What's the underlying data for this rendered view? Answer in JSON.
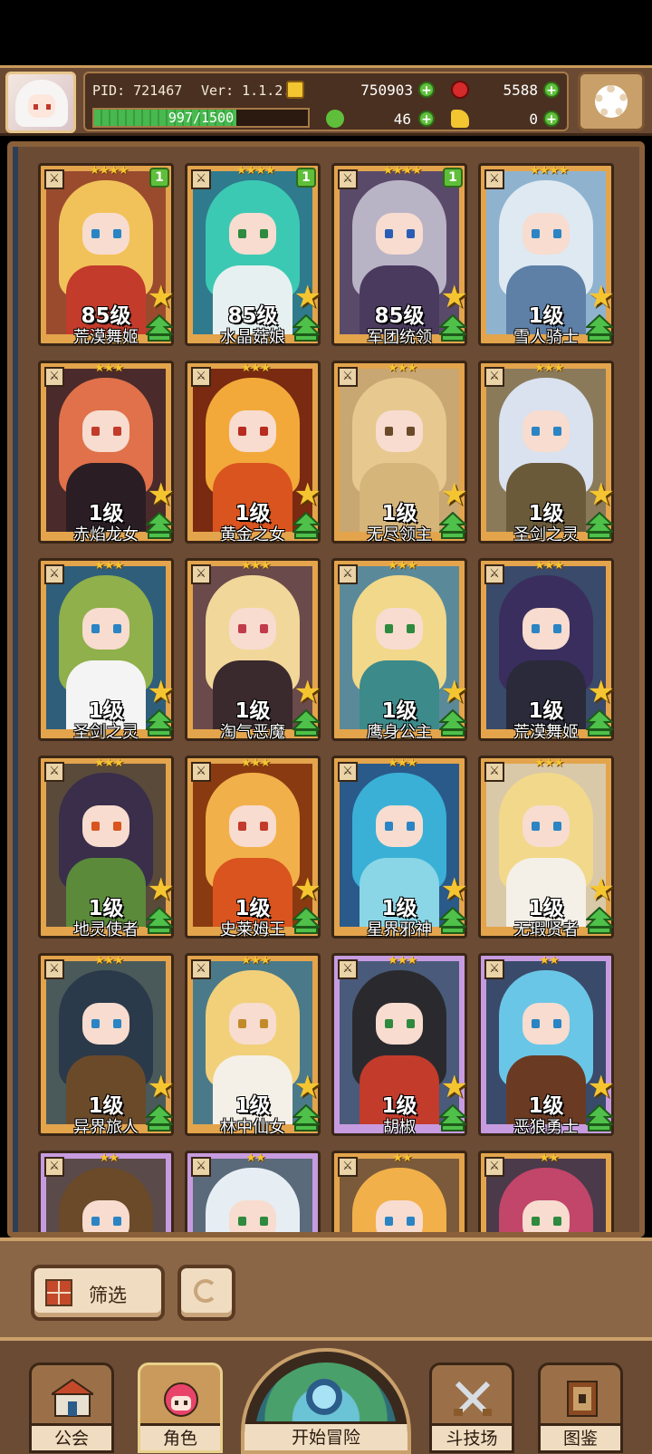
{
  "player": {
    "pid": "PID: 721467",
    "version": "Ver: 1.1.2.0",
    "exp_text": "997/1500",
    "exp_progress": 0.665
  },
  "resources": {
    "gold": "750903",
    "gems": "5588",
    "clover": "46",
    "horn": "0"
  },
  "heroes": [
    {
      "level": "85级",
      "name": "荒漠舞姬",
      "stars": "★★★★",
      "badge": "1",
      "frame": "orange",
      "hair": "#f2c25a",
      "outfit": "#c23b2b",
      "eye": "#2b84c4",
      "bg": "#9a4b2e"
    },
    {
      "level": "85级",
      "name": "水晶菇娘",
      "stars": "★★★★",
      "badge": "1",
      "frame": "orange",
      "hair": "#3cc9b4",
      "outfit": "#e7f0f0",
      "eye": "#2e8a3e",
      "bg": "#2f7a8c"
    },
    {
      "level": "85级",
      "name": "军团统领",
      "stars": "★★★★",
      "badge": "1",
      "frame": "orange",
      "hair": "#b9b3c6",
      "outfit": "#4a3a5e",
      "eye": "#2b5db6",
      "bg": "#5a4a6a"
    },
    {
      "level": "1级",
      "name": "雪人骑士",
      "stars": "★★★★",
      "badge": "",
      "frame": "orange",
      "hair": "#dfe9f2",
      "outfit": "#5e7fa6",
      "eye": "#2b84c4",
      "bg": "#8fb3cf"
    },
    {
      "level": "1级",
      "name": "赤焰龙女",
      "stars": "★★★",
      "badge": "",
      "frame": "orange",
      "hair": "#e0714a",
      "outfit": "#2a1e24",
      "eye": "#c23b2b",
      "bg": "#4a2a2a"
    },
    {
      "level": "1级",
      "name": "黄金之女",
      "stars": "★★★",
      "badge": "",
      "frame": "orange",
      "hair": "#f2a93a",
      "outfit": "#d9541e",
      "eye": "#b82b1f",
      "bg": "#7a2a10"
    },
    {
      "level": "1级",
      "name": "无尽领主",
      "stars": "★★★",
      "badge": "",
      "frame": "orange",
      "hair": "#e7c98f",
      "outfit": "#d6b57a",
      "eye": "#6b4a2a",
      "bg": "#c9a772"
    },
    {
      "level": "1级",
      "name": "圣剑之灵",
      "stars": "★★★",
      "badge": "",
      "frame": "orange",
      "hair": "#d9e2ee",
      "outfit": "#6b5a3a",
      "eye": "#2b84c4",
      "bg": "#8a7a5a"
    },
    {
      "level": "1级",
      "name": "圣剑之灵",
      "stars": "★★★",
      "badge": "",
      "frame": "orange",
      "hair": "#8fb04a",
      "outfit": "#f4f4f4",
      "eye": "#2b84c4",
      "bg": "#2e5e7a"
    },
    {
      "level": "1级",
      "name": "淘气恶魔",
      "stars": "★★★",
      "badge": "",
      "frame": "orange",
      "hair": "#f2d79a",
      "outfit": "#3a2a2e",
      "eye": "#c23b4a",
      "bg": "#6a4a4a"
    },
    {
      "level": "1级",
      "name": "鹰身公主",
      "stars": "★★★",
      "badge": "",
      "frame": "orange",
      "hair": "#f2d88a",
      "outfit": "#3c8a8a",
      "eye": "#2e8a3e",
      "bg": "#5a8a9a"
    },
    {
      "level": "1级",
      "name": "荒漠舞姬",
      "stars": "★★★",
      "badge": "",
      "frame": "orange",
      "hair": "#3a2e5e",
      "outfit": "#2a2a3a",
      "eye": "#2b84c4",
      "bg": "#3a4a6a"
    },
    {
      "level": "1级",
      "name": "地灵使者",
      "stars": "★★★",
      "badge": "",
      "frame": "orange",
      "hair": "#3a2e4a",
      "outfit": "#5a8a3a",
      "eye": "#d9541e",
      "bg": "#5a4a3a"
    },
    {
      "level": "1级",
      "name": "史莱姆王",
      "stars": "★★★",
      "badge": "",
      "frame": "orange",
      "hair": "#f2b04a",
      "outfit": "#d9541e",
      "eye": "#c23b2b",
      "bg": "#8a3a10"
    },
    {
      "level": "1级",
      "name": "星界邪神",
      "stars": "★★★",
      "badge": "",
      "frame": "orange",
      "hair": "#3ab0d6",
      "outfit": "#8ad6e6",
      "eye": "#2b84c4",
      "bg": "#2a5a8a"
    },
    {
      "level": "1级",
      "name": "无瑕贤者",
      "stars": "★★★",
      "badge": "",
      "frame": "orange",
      "hair": "#f2d88a",
      "outfit": "#f4f0e8",
      "eye": "#2b84c4",
      "bg": "#d9c9a8"
    },
    {
      "level": "1级",
      "name": "异界旅人",
      "stars": "★★★",
      "badge": "",
      "frame": "orange",
      "hair": "#2a3a4a",
      "outfit": "#6b4a2a",
      "eye": "#2b84c4",
      "bg": "#4a5a5a"
    },
    {
      "level": "1级",
      "name": "林中仙女",
      "stars": "★★★",
      "badge": "",
      "frame": "orange",
      "hair": "#f2d07a",
      "outfit": "#f4f0e8",
      "eye": "#c28a2a",
      "bg": "#4a7a8a"
    },
    {
      "level": "1级",
      "name": "胡椒",
      "stars": "★★★",
      "badge": "",
      "frame": "purple",
      "hair": "#2a2a2e",
      "outfit": "#c23b2b",
      "eye": "#2e8a3e",
      "bg": "#4a5a7a"
    },
    {
      "level": "1级",
      "name": "恶狼勇士",
      "stars": "★★",
      "badge": "",
      "frame": "purple",
      "hair": "#6ac6e6",
      "outfit": "#6b3a22",
      "eye": "#2b84c4",
      "bg": "#3a4a6a"
    },
    {
      "level": "",
      "name": "",
      "stars": "★★",
      "badge": "",
      "frame": "purple",
      "hair": "#6b4a2a",
      "outfit": "#6b4a2a",
      "eye": "#2b84c4",
      "bg": "#5a4a4a"
    },
    {
      "level": "",
      "name": "",
      "stars": "★★",
      "badge": "",
      "frame": "purple",
      "hair": "#e6eef4",
      "outfit": "#6b8a6a",
      "eye": "#2e8a3e",
      "bg": "#5a6a7a"
    },
    {
      "level": "",
      "name": "",
      "stars": "★★",
      "badge": "",
      "frame": "orange",
      "hair": "#f2b04a",
      "outfit": "#f2b04a",
      "eye": "#2b84c4",
      "bg": "#7a5a3a"
    },
    {
      "level": "",
      "name": "",
      "stars": "★★",
      "badge": "",
      "frame": "orange",
      "hair": "#c2456a",
      "outfit": "#3a2a3a",
      "eye": "#2e8a3e",
      "bg": "#4a3a4a"
    }
  ],
  "controls": {
    "filter_label": "筛选"
  },
  "nav": {
    "guild": "公会",
    "character": "角色",
    "adventure": "开始冒险",
    "arena": "斗技场",
    "codex": "图鉴"
  }
}
